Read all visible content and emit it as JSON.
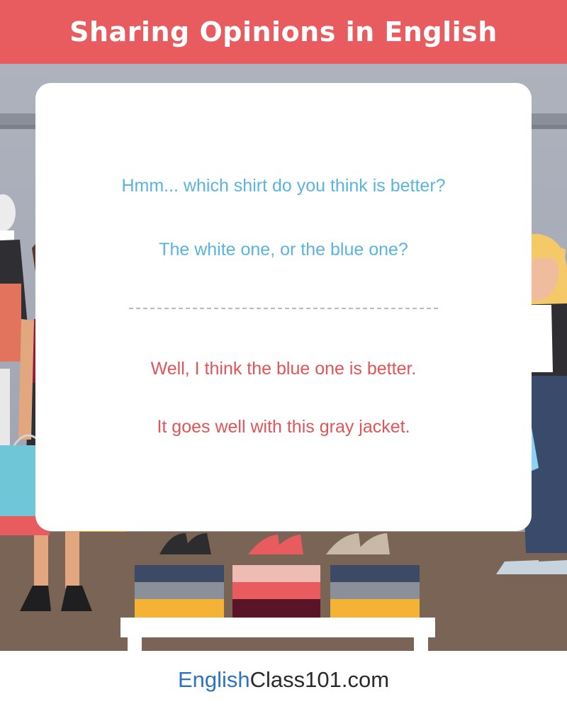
{
  "header": {
    "title": "Sharing Opinions in English"
  },
  "dialogue": {
    "question_1": "Hmm... which shirt do you think is better?",
    "question_2": "The white one, or the blue one?",
    "answer_1": "Well, I think the blue one is better.",
    "answer_2": "It goes well with this gray jacket."
  },
  "footer": {
    "brand_part_1": "English",
    "brand_part_2": "Class101.com"
  },
  "colors": {
    "header_bg": "#e85c5f",
    "question_text": "#5ab4de",
    "answer_text": "#e05558",
    "brand_blue": "#2b73c8"
  },
  "illustration": {
    "left_person": "woman-in-red-top-icon",
    "right_person": "blonde-woman-holding-shirt-icon",
    "held_item": "blue-sweater-icon",
    "props": [
      "shopping-bags-icon",
      "high-heels-icon",
      "folded-clothes-icon",
      "display-table-icon"
    ]
  }
}
